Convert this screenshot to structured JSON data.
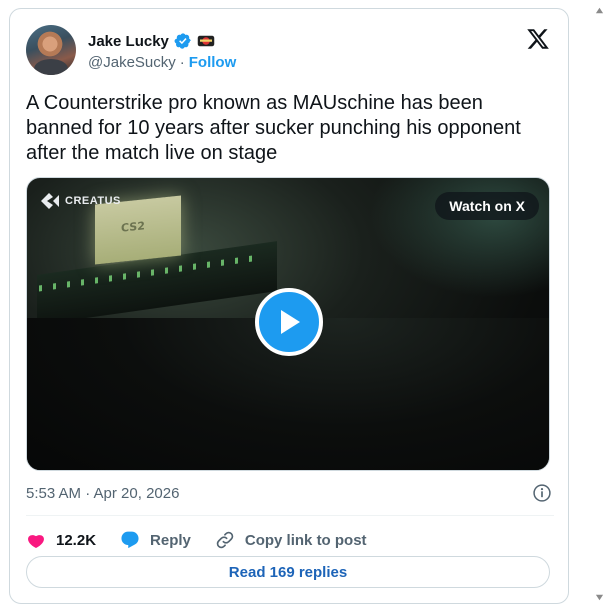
{
  "author": {
    "name": "Jake Lucky",
    "handle": "@JakeSucky",
    "separator": "·",
    "follow_label": "Follow"
  },
  "tweet": {
    "text": "A Counterstrike pro known as MAUschine has been banned for 10 years after sucker punching his opponent after the match live on stage",
    "timestamp": "5:53 AM · Apr 20, 2026"
  },
  "media": {
    "brand_text": "CREATUS",
    "screen_text": "CS2",
    "watch_label": "Watch on X"
  },
  "actions": {
    "likes_count": "12.2K",
    "reply_label": "Reply",
    "copy_label": "Copy link to post"
  },
  "read_replies_label": "Read 169 replies",
  "colors": {
    "accent": "#1d9bf0",
    "like": "#f91880",
    "muted": "#536471"
  },
  "icons": [
    "verified-icon",
    "badge-icon",
    "x-logo-icon",
    "play-icon",
    "info-icon",
    "heart-icon",
    "reply-icon",
    "link-icon"
  ]
}
